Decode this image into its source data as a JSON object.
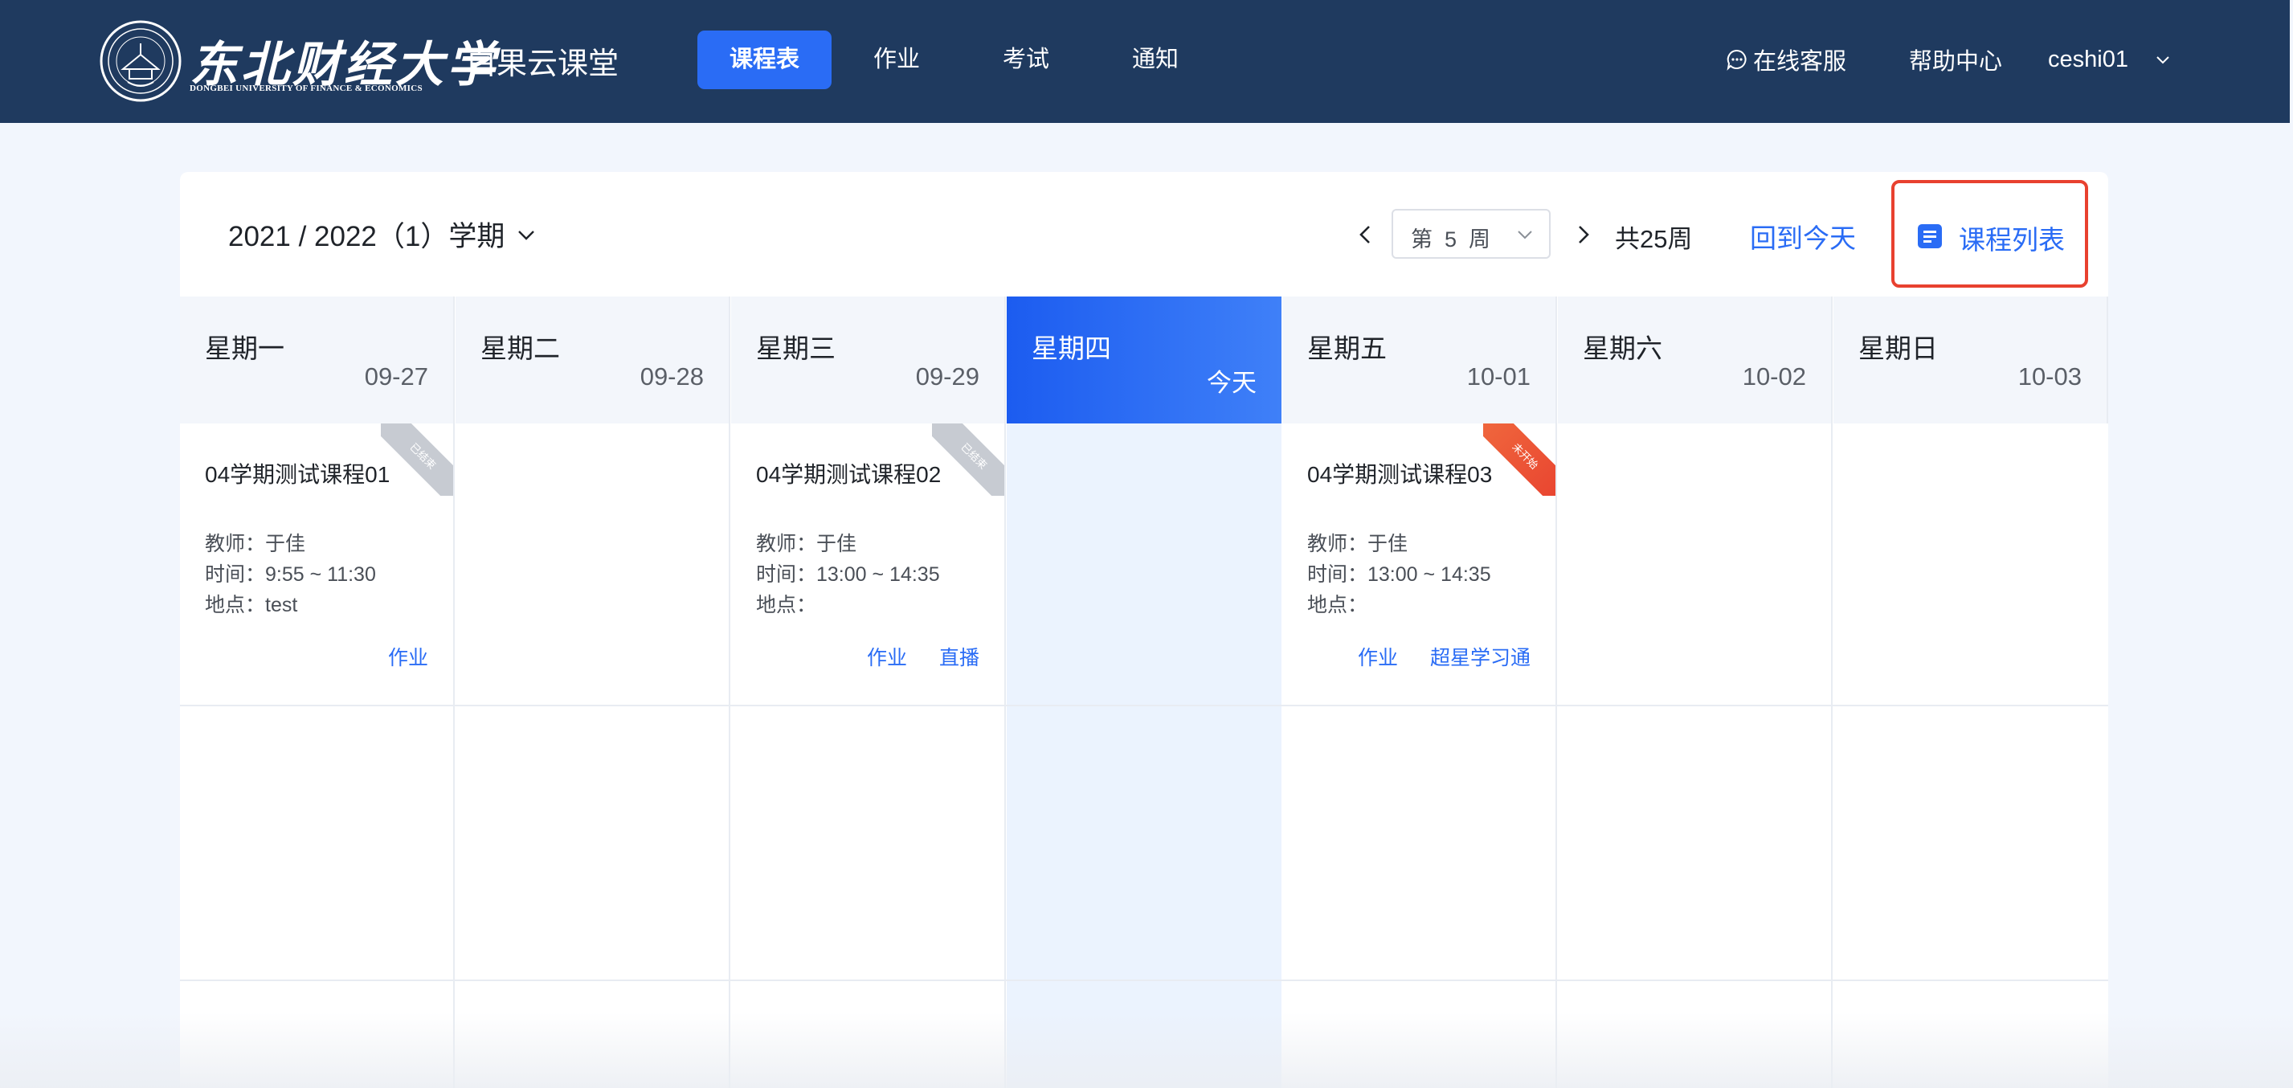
{
  "header": {
    "logo_cn": "东北财经大学",
    "logo_en": "DONGBEI UNIVERSITY OF FINANCE & ECONOMICS",
    "app_name": "白果云课堂",
    "nav": [
      {
        "label": "课程表",
        "active": true
      },
      {
        "label": "作业",
        "active": false
      },
      {
        "label": "考试",
        "active": false
      },
      {
        "label": "通知",
        "active": false
      }
    ],
    "service_label": "在线客服",
    "help_label": "帮助中心",
    "username": "ceshi01",
    "icons": [
      "chat-bubble-icon",
      "chevron-down-icon"
    ]
  },
  "toolbar": {
    "term": "2021 / 2022（1）学期",
    "week_label": "第  5  周",
    "total_weeks": "共25周",
    "back_today": "回到今天",
    "course_list": "课程列表",
    "icons": [
      "chevron-left-icon",
      "chevron-right-icon",
      "list-doc-icon"
    ]
  },
  "days": [
    {
      "name": "星期一",
      "date": "09-27",
      "today": false
    },
    {
      "name": "星期二",
      "date": "09-28",
      "today": false
    },
    {
      "name": "星期三",
      "date": "09-29",
      "today": false
    },
    {
      "name": "星期四",
      "date": "今天",
      "today": true
    },
    {
      "name": "星期五",
      "date": "10-01",
      "today": false
    },
    {
      "name": "星期六",
      "date": "10-02",
      "today": false
    },
    {
      "name": "星期日",
      "date": "10-03",
      "today": false
    }
  ],
  "courses": [
    {
      "day_index": 0,
      "title": "04学期测试课程01",
      "teacher": "教师：于佳",
      "time": "时间：9:55 ~ 11:30",
      "place": "地点：test",
      "status": "已结束",
      "links": [
        "作业"
      ]
    },
    {
      "day_index": 2,
      "title": "04学期测试课程02",
      "teacher": "教师：于佳",
      "time": "时间：13:00 ~ 14:35",
      "place": "地点：",
      "status": "已结束",
      "links": [
        "作业",
        "直播"
      ]
    },
    {
      "day_index": 4,
      "title": "04学期测试课程03",
      "teacher": "教师：于佳",
      "time": "时间：13:00 ~ 14:35",
      "place": "地点：",
      "status": "未开始",
      "links": [
        "作业",
        "超星学习通"
      ]
    }
  ],
  "colors": {
    "header_bg": "#1f3a5f",
    "accent": "#2a6cf5",
    "page_bg": "#f2f6fd",
    "today_col": "#ebf3fe",
    "highlight_border": "#e8412f",
    "ribbon_done": "#c7cbd2",
    "ribbon_todo": "#e8412f"
  }
}
